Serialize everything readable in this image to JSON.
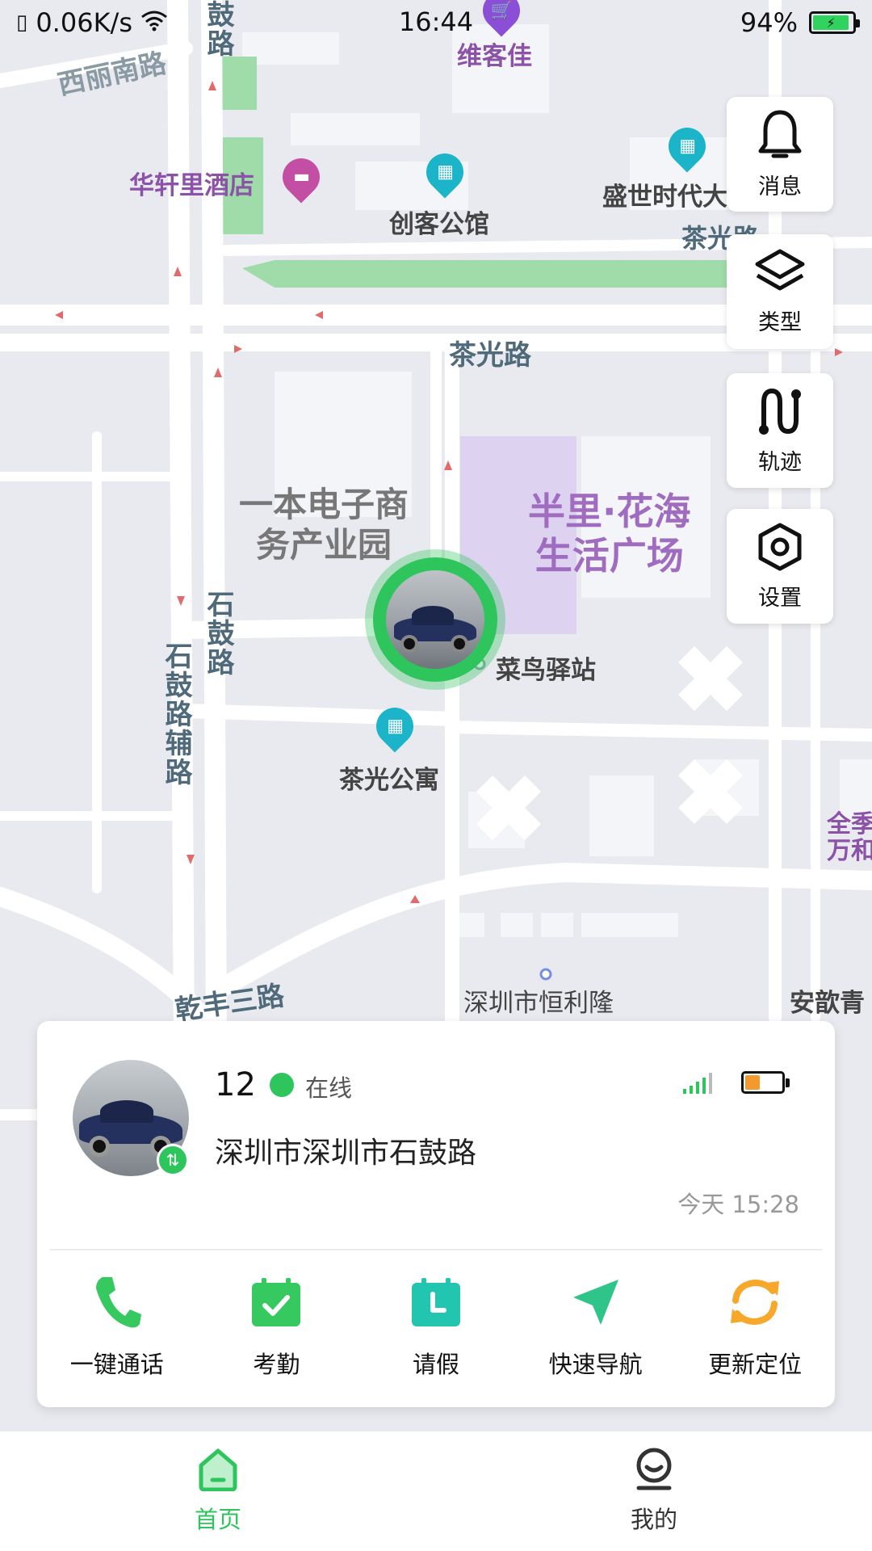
{
  "status_bar": {
    "speed": "0.06K/s",
    "time": "16:44",
    "battery": "94%"
  },
  "map": {
    "roads": {
      "xili_south": "西丽南路",
      "shigu_top": "鼓路",
      "chaguang_main": "茶光路",
      "chaguang_upper": "茶光路",
      "shigu": "石鼓路",
      "shigu_aux": "石鼓路辅路",
      "qianfeng": "乾丰三路"
    },
    "pois": {
      "weikejia": "维客佳",
      "huaxuanli": "华轩里酒店",
      "chuangke": "创客公馆",
      "shengshi": "盛世时代大",
      "yiben_park": "一本电子商\n务产业园",
      "banli": "半里·花海\n生活广场",
      "cainiao": "菜鸟驿站",
      "chaguang_apt": "茶光公寓",
      "henglilong": "深圳市恒利隆",
      "anxin": "安歆青",
      "quanji": "全季\n万和"
    }
  },
  "side_buttons": [
    {
      "label": "消息",
      "icon": "bell-icon"
    },
    {
      "label": "类型",
      "icon": "layers-icon"
    },
    {
      "label": "轨迹",
      "icon": "track-icon"
    },
    {
      "label": "设置",
      "icon": "settings-icon"
    }
  ],
  "card": {
    "vehicle_id": "12",
    "status": "在线",
    "status_color": "#2ec55c",
    "address": "深圳市深圳市石鼓路",
    "timestamp": "今天 15:28",
    "battery_level": 0.4,
    "battery_color": "#f29a2e",
    "actions": [
      {
        "label": "一键通话",
        "icon": "phone-icon"
      },
      {
        "label": "考勤",
        "icon": "attendance-icon"
      },
      {
        "label": "请假",
        "icon": "leave-icon"
      },
      {
        "label": "快速导航",
        "icon": "navigation-icon"
      },
      {
        "label": "更新定位",
        "icon": "refresh-location-icon"
      }
    ]
  },
  "tabs": [
    {
      "label": "首页",
      "icon": "home-icon",
      "active": true
    },
    {
      "label": "我的",
      "icon": "profile-icon",
      "active": false
    }
  ],
  "colors": {
    "accent": "#2ec55c",
    "map_bg": "#e9eaef"
  }
}
